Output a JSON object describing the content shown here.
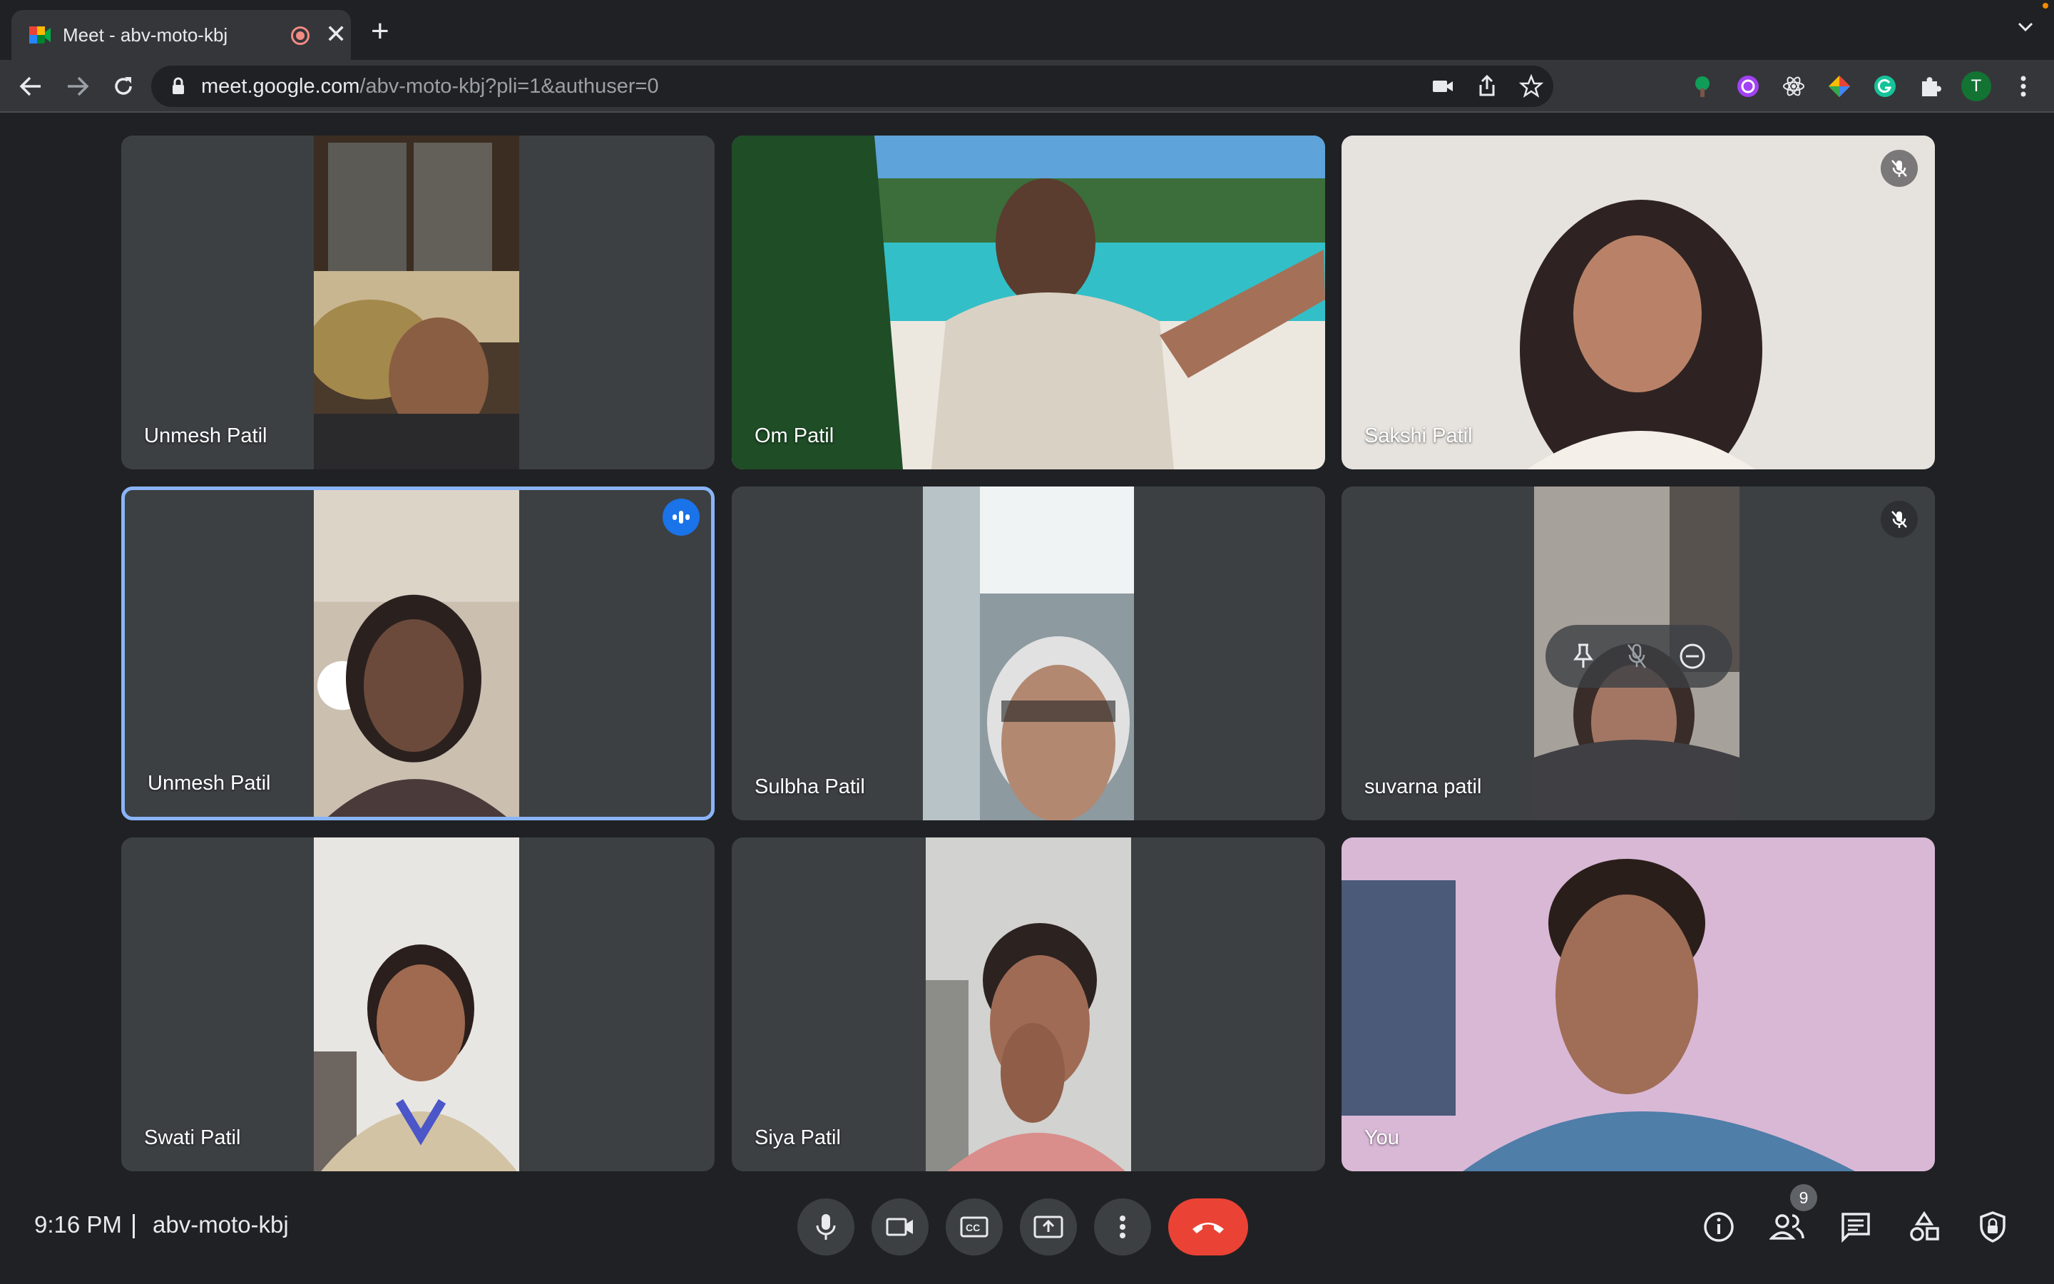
{
  "browser": {
    "tab_title": "Meet - abv-moto-kbj",
    "tab_close": "✕",
    "new_tab": "+",
    "url_host": "meet.google.com",
    "url_path": "/abv-moto-kbj?pli=1&authuser=0",
    "profile_initial": "T"
  },
  "colors": {
    "accent_blue": "#8ab4f8",
    "hangup_red": "#ea4335",
    "tile_bg": "#3c4043",
    "page_bg": "#202124"
  },
  "tiles": [
    {
      "name": "Unmesh Patil",
      "icon": "none"
    },
    {
      "name": "Om Patil",
      "icon": "none"
    },
    {
      "name": "Sakshi Patil",
      "icon": "mic-off-icon"
    },
    {
      "name": "Unmesh Patil",
      "icon": "speaking-indicator-icon",
      "speaking": true
    },
    {
      "name": "Sulbha Patil",
      "icon": "none"
    },
    {
      "name": "suvarna patil",
      "icon": "mic-off-icon",
      "hover_actions": [
        "pin-icon",
        "mute-icon",
        "remove-icon"
      ]
    },
    {
      "name": "Swati Patil",
      "icon": "none"
    },
    {
      "name": "Siya Patil",
      "icon": "none"
    },
    {
      "name": "You",
      "icon": "none"
    }
  ],
  "bottom_bar": {
    "time": "9:16 PM",
    "meeting_code": "abv-moto-kbj",
    "participant_count": "9",
    "controls": [
      "microphone-icon",
      "camera-icon",
      "captions-icon",
      "present-icon",
      "more-options-icon",
      "hangup-icon"
    ],
    "right_controls": [
      "info-icon",
      "people-icon",
      "chat-icon",
      "activities-icon",
      "host-controls-icon"
    ]
  }
}
